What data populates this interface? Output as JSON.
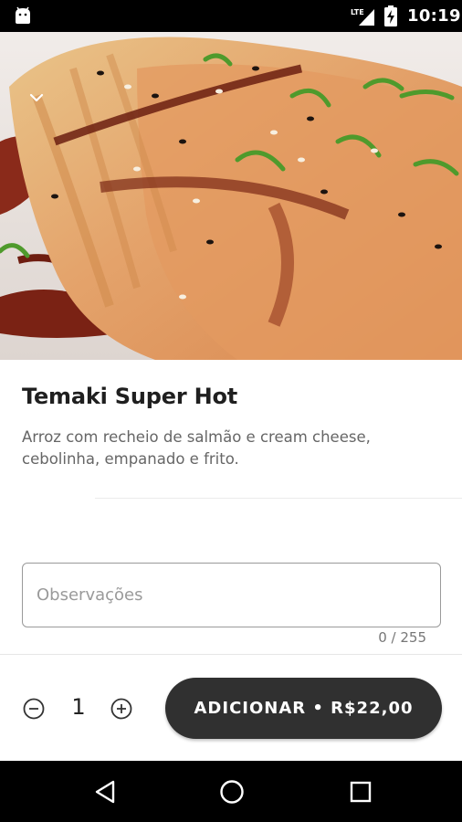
{
  "status_bar": {
    "time": "10:19",
    "network_label": "LTE",
    "icons": [
      "android-icon",
      "lte-signal-icon",
      "battery-charging-icon"
    ]
  },
  "hero": {
    "image": "temaki-super-hot-photo",
    "collapse_icon": "chevron-down-icon"
  },
  "product": {
    "title": "Temaki Super Hot",
    "description": "Arroz com recheio de salmão e cream cheese, cebolinha, empanado e frito."
  },
  "observations": {
    "placeholder": "Observações",
    "value": "",
    "counter": "0 / 255"
  },
  "footer": {
    "quantity": "1",
    "minus_icon": "minus-circle-icon",
    "plus_icon": "plus-circle-icon",
    "add_button_label": "ADICIONAR • R$22,00"
  },
  "nav_bar": {
    "icons": [
      "back-triangle-icon",
      "home-circle-icon",
      "recents-square-icon"
    ]
  },
  "colors": {
    "button_bg": "#303030",
    "button_text": "#ffffff",
    "title_text": "#1f1f1f",
    "description_text": "#666666",
    "field_border": "#9a9a9a",
    "system_bars": "#000000"
  }
}
